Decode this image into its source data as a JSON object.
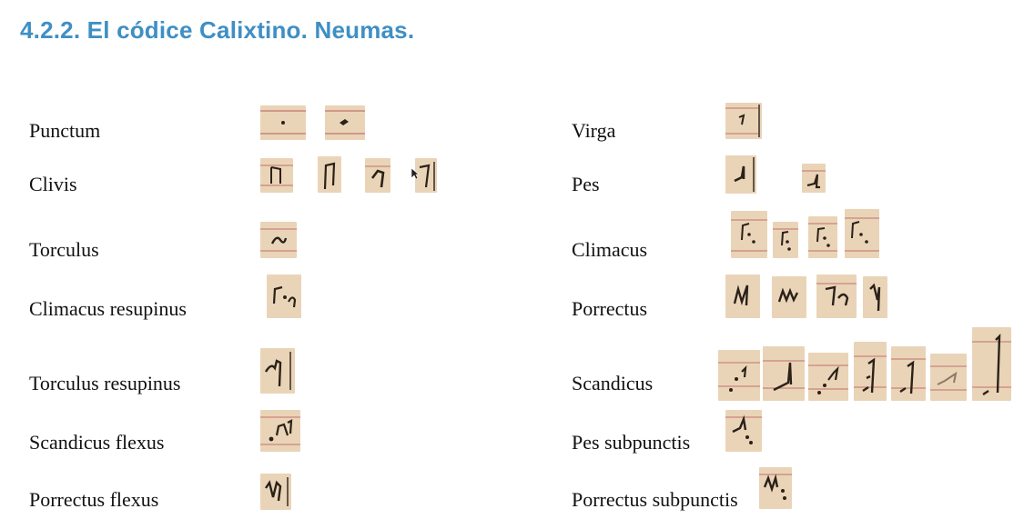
{
  "title": "4.2.2. El códice Calixtino. Neumas.",
  "colors": {
    "title": "#3f8fc4",
    "parchment": "#ead4b8",
    "staff_line": "#c9837a",
    "ink": "#2a2118"
  },
  "neumes": {
    "punctum": "Punctum",
    "clivis": "Clivis",
    "torculus": "Torculus",
    "climacus_resupinus": "Climacus resupinus",
    "torculus_resupinus": "Torculus resupinus",
    "scandicus_flexus": "Scandicus flexus",
    "porrectus_flexus": "Porrectus flexus",
    "virga": "Virga",
    "pes": "Pes",
    "climacus": "Climacus",
    "porrectus": "Porrectus",
    "scandicus": "Scandicus",
    "pes_subpunctis": "Pes subpunctis",
    "porrectus_subpunctis": "Porrectus subpunctis"
  }
}
